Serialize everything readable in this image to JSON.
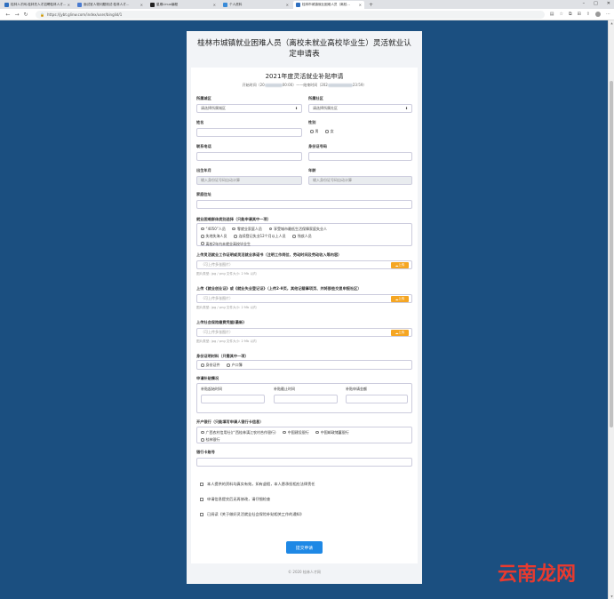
{
  "browser": {
    "tabs": [
      {
        "label": "桂林人才网-桂林先人才招聘桂林人才…",
        "active": false,
        "color": "#2f6fbf"
      },
      {
        "label": "面试官人物问题测试·桂林人才…",
        "active": false,
        "color": "#4a7bd0"
      },
      {
        "label": "星期Linux编程",
        "active": false,
        "color": "#222"
      },
      {
        "label": "个人资料",
        "active": false,
        "color": "#3a8bd8"
      },
      {
        "label": "桂林市城镇就业困难人员（离校…",
        "active": true,
        "color": "#2f6fbf"
      }
    ],
    "url": "https://jybt.glinw.com/index/user/binglid/1"
  },
  "page": {
    "title": "桂林市城镇就业困难人员（离校未就业高校毕业生）灵活就业认定申请表",
    "card_title": "2021年度灵活就业补贴申请",
    "time_start_label": "开始时间（20",
    "time_start_tail": "00:00）",
    "time_separator": "——结束时间（202",
    "time_end_tail": "23:59）"
  },
  "form": {
    "district_label": "所属城区",
    "district_placeholder": "请选择所属城区",
    "community_label": "所属社区",
    "community_placeholder": "请选择所属社区",
    "name_label": "姓名",
    "gender_label": "性别",
    "gender_options": [
      "男",
      "女"
    ],
    "phone_label": "联系电话",
    "id_label": "身份证号码",
    "birth_label": "出生年月",
    "birth_placeholder": "输入身份证号码自动计算",
    "age_label": "年龄",
    "age_placeholder": "输入身份证号码自动计算",
    "address_label": "家庭住址",
    "category_label": "就业困难群体类别选择（只能申请其中一项）",
    "categories_row1": [
      "“4050”人员",
      "零就业家庭人员",
      "享受城市最低生活保障家庭失业人"
    ],
    "categories_row2": [
      "失地失海人员",
      "连续登记失业12个月以上人员",
      "残疾人员"
    ],
    "categories_row3": [
      "离校2年内未就业高校毕业生"
    ],
    "upload1_label": "上传灵活就业工作证明或灵活就业承诺书（注明工作岗位、劳动时间及劳动收入等内容）",
    "upload2_label": "上传《就业创业证》或《就业失业登记证》（上传2-9页，其他记载事项页、并将那些交显申报社区）",
    "upload3_label": "上传社会保险缴费凭据(最新)",
    "upload_placeholder": "（可上传多张图片）",
    "upload_button": "上传",
    "upload_hint": "图片类型: jpg / png 文件大小: 2 Mb 以内",
    "idtype_label": "身份证明材料（只需其中一项）",
    "idtype_options": [
      "身份证件",
      "户口簿"
    ],
    "subsidy_label": "申请补贴情况",
    "subsidy_cols": [
      "补贴起始时间",
      "补贴截止时间",
      "补贴申请金额"
    ],
    "bank_label": "开户银行（只能填写申请人银行卡信息）",
    "bank_row1": [
      "广西农村信用社(广西桂林漓江农村合作银行)",
      "中国建设银行",
      "中国邮政储蓄银行"
    ],
    "bank_row2": [
      "桂林银行"
    ],
    "card_label": "银行卡账号",
    "agree1": "本人提供的资料均真实有效，如有虚假，本人愿承担相应法律责任",
    "agree2": "申请信息提交后无再修改，请仔细检查",
    "agree3": "已阅读《关于做好灵活就业社会保险补贴相关工作的通知》",
    "submit_label": "提交申请"
  },
  "footer": "© 2020 桂林人才网",
  "watermark": "云南龙网"
}
